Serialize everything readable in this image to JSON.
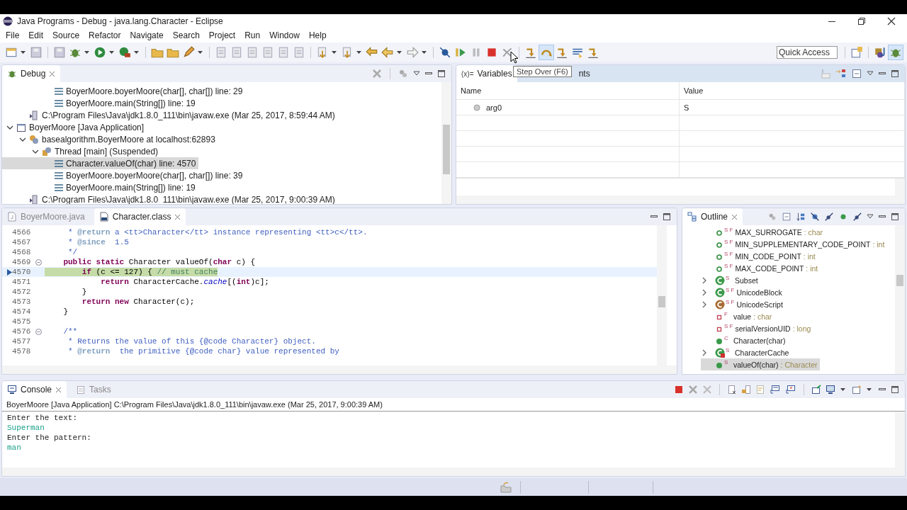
{
  "window": {
    "title": "Java Programs - Debug - java.lang.Character - Eclipse"
  },
  "menu": [
    "File",
    "Edit",
    "Source",
    "Refactor",
    "Navigate",
    "Search",
    "Project",
    "Run",
    "Window",
    "Help"
  ],
  "toolbar": {
    "quick_access": {
      "placeholder": "Quick Access"
    },
    "tooltip": "Step Over (F6)"
  },
  "debug": {
    "tab": {
      "label": "Debug"
    },
    "tree": [
      {
        "label": "BoyerMoore.boyerMoore(char[], char[]) line: 29",
        "kind": "frame",
        "selected": false
      },
      {
        "label": "BoyerMoore.main(String[]) line: 19",
        "kind": "frame",
        "selected": false
      },
      {
        "label": "C:\\Program Files\\Java\\jdk1.8.0_111\\bin\\javaw.exe (Mar 25, 2017, 8:59:44 AM)",
        "kind": "process",
        "selected": false
      },
      {
        "label": "BoyerMoore [Java Application]",
        "kind": "launch",
        "selected": false,
        "expanded": true,
        "children": [
          {
            "label": "basealgorithm.BoyerMoore at localhost:62893",
            "kind": "target",
            "selected": false,
            "expanded": true,
            "children": [
              {
                "label": "Thread [main] (Suspended)",
                "kind": "thread",
                "selected": false,
                "expanded": true,
                "children": [
                  {
                    "label": "Character.valueOf(char) line: 4570",
                    "kind": "frame",
                    "selected": true
                  },
                  {
                    "label": "BoyerMoore.boyerMoore(char[], char[]) line: 39",
                    "kind": "frame",
                    "selected": false
                  },
                  {
                    "label": "BoyerMoore.main(String[]) line: 19",
                    "kind": "frame",
                    "selected": false
                  }
                ]
              }
            ]
          },
          {
            "label": "C:\\Program Files\\Java\\jdk1.8.0_111\\bin\\javaw.exe (Mar 25, 2017, 9:00:39 AM)",
            "kind": "process",
            "selected": false
          }
        ]
      }
    ]
  },
  "variables": {
    "tabs": [
      {
        "icon_text": "(x)=",
        "label": "Variables",
        "selected": true
      },
      {
        "label": "nts",
        "selected": false
      }
    ],
    "columns": [
      "Name",
      "Value"
    ],
    "rows": [
      {
        "name": "arg0",
        "value": "S"
      }
    ]
  },
  "editor": {
    "tabs": [
      {
        "label": "BoyerMoore.java",
        "selected": false
      },
      {
        "label": "Character.class",
        "selected": true
      }
    ],
    "lines": [
      {
        "number": "4566",
        "current": false,
        "segments": [
          {
            "text": "     * ",
            "kind": "doc"
          },
          {
            "text": "@return",
            "kind": "doctag"
          },
          {
            "text": " a <tt>Character</tt> instance representing <tt>c</tt>.",
            "kind": "doc"
          }
        ]
      },
      {
        "number": "4567",
        "current": false,
        "segments": [
          {
            "text": "     * ",
            "kind": "doc"
          },
          {
            "text": "@since",
            "kind": "doctag"
          },
          {
            "text": "  1.5",
            "kind": "doc"
          }
        ]
      },
      {
        "number": "4568",
        "current": false,
        "segments": [
          {
            "text": "     */",
            "kind": "doc"
          }
        ]
      },
      {
        "number": "4569",
        "current": false,
        "foldable": true,
        "segments": [
          {
            "text": "    public",
            "kind": "kw"
          },
          {
            "text": " static",
            "kind": "kw"
          },
          {
            "text": " Character valueOf(",
            "kind": "plain"
          },
          {
            "text": "char",
            "kind": "kw"
          },
          {
            "text": " c) {",
            "kind": "plain"
          }
        ]
      },
      {
        "number": "4570",
        "current": true,
        "segments": [
          {
            "text": "        if",
            "kind": "kw"
          },
          {
            "text": " (c <= 127) { ",
            "kind": "plain"
          },
          {
            "text": "// must cache",
            "kind": "comment"
          }
        ]
      },
      {
        "number": "4571",
        "current": false,
        "segments": [
          {
            "text": "            return",
            "kind": "kw"
          },
          {
            "text": " CharacterCache.",
            "kind": "plain"
          },
          {
            "text": "cache",
            "kind": "field"
          },
          {
            "text": "[(",
            "kind": "plain"
          },
          {
            "text": "int",
            "kind": "kw"
          },
          {
            "text": ")c];",
            "kind": "plain"
          }
        ]
      },
      {
        "number": "4572",
        "current": false,
        "segments": [
          {
            "text": "        }",
            "kind": "plain"
          }
        ]
      },
      {
        "number": "4573",
        "current": false,
        "segments": [
          {
            "text": "        return",
            "kind": "kw"
          },
          {
            "text": " new",
            "kind": "kw"
          },
          {
            "text": " Character(c);",
            "kind": "plain"
          }
        ]
      },
      {
        "number": "4574",
        "current": false,
        "segments": [
          {
            "text": "    }",
            "kind": "plain"
          }
        ]
      },
      {
        "number": "4575",
        "current": false
      },
      {
        "number": "4576",
        "current": false,
        "foldable": true,
        "segments": [
          {
            "text": "    /**",
            "kind": "doc"
          }
        ]
      },
      {
        "number": "4577",
        "current": false,
        "segments": [
          {
            "text": "     * Returns the value of this {@code Character} object.",
            "kind": "doc"
          }
        ]
      },
      {
        "number": "4578",
        "current": false,
        "segments": [
          {
            "text": "     * ",
            "kind": "doc"
          },
          {
            "text": "@return",
            "kind": "doctag"
          },
          {
            "text": "  the primitive {@code char} value represented by",
            "kind": "doc"
          }
        ]
      }
    ]
  },
  "outline": {
    "tab": {
      "label": "Outline"
    },
    "items": [
      {
        "kind": "field",
        "modifiers": "S F",
        "name": "MAX_SURROGATE",
        "type": ": char",
        "selected": false
      },
      {
        "kind": "field",
        "modifiers": "S F",
        "name": "MIN_SUPPLEMENTARY_CODE_POINT",
        "type": ": int",
        "selected": false
      },
      {
        "kind": "field",
        "modifiers": "S F",
        "name": "MIN_CODE_POINT",
        "type": ": int",
        "selected": false
      },
      {
        "kind": "field",
        "modifiers": "S F",
        "name": "MAX_CODE_POINT",
        "type": ": int",
        "selected": false
      },
      {
        "kind": "class",
        "modifiers": "S",
        "name": "Subset",
        "expanded": false,
        "selected": false
      },
      {
        "kind": "class",
        "modifiers": "S F",
        "name": "UnicodeBlock",
        "expanded": false,
        "selected": false
      },
      {
        "kind": "enum",
        "modifiers": "S F",
        "name": "UnicodeScript",
        "expanded": false,
        "selected": false
      },
      {
        "kind": "private_field",
        "modifiers": "F",
        "name": "value",
        "type": ": char",
        "selected": false
      },
      {
        "kind": "private_field",
        "modifiers": "S F",
        "name": "serialVersionUID",
        "type": ": long",
        "selected": false
      },
      {
        "kind": "method",
        "modifiers": "C",
        "name": "Character(char)",
        "selected": false
      },
      {
        "kind": "private_class",
        "modifiers": "S",
        "name": "CharacterCache",
        "expanded": false,
        "selected": false
      },
      {
        "kind": "method",
        "modifiers": "S",
        "name": "valueOf(char)",
        "type": ": Character",
        "selected": true
      }
    ]
  },
  "console": {
    "tabs": [
      {
        "label": "Console",
        "selected": true
      },
      {
        "label": "Tasks",
        "selected": false
      }
    ],
    "header": "BoyerMoore [Java Application] C:\\Program Files\\Java\\jdk1.8.0_111\\bin\\javaw.exe (Mar 25, 2017, 9:00:39 AM)",
    "lines": [
      {
        "text": "Enter the text:",
        "kind": "output"
      },
      {
        "text": "Superman",
        "kind": "input"
      },
      {
        "text": "Enter the pattern:",
        "kind": "output"
      },
      {
        "text": "man",
        "kind": "input"
      }
    ]
  }
}
